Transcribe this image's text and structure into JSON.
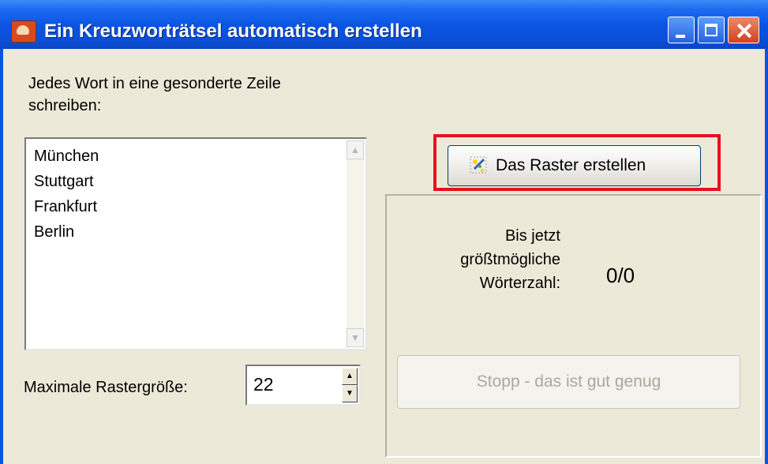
{
  "window": {
    "title": "Ein Kreuzworträtsel automatisch erstellen",
    "icon": "app-icon",
    "controls": [
      "minimize-icon",
      "maximize-icon",
      "close-icon"
    ]
  },
  "instructions": {
    "line1": "Jedes Wort in eine gesonderte Zeile",
    "line2": "schreiben:"
  },
  "word_list": {
    "items": [
      "München",
      "Stuttgart",
      "Frankfurt",
      "Berlin"
    ]
  },
  "grid_size": {
    "label": "Maximale Rastergröße:",
    "value": "22"
  },
  "create_button": {
    "label": "Das Raster erstellen",
    "icon": "magic-wand-icon"
  },
  "stats": {
    "label_line1": "Bis jetzt",
    "label_line2": "größtmögliche",
    "label_line3": "Wörterzahl:",
    "value": "0/0"
  },
  "stop_button": {
    "label": "Stopp - das ist gut genug",
    "enabled": false
  },
  "colors": {
    "titlebar": "#0a55e4",
    "dialog_bg": "#ece9d8",
    "highlight": "#e8101d"
  }
}
